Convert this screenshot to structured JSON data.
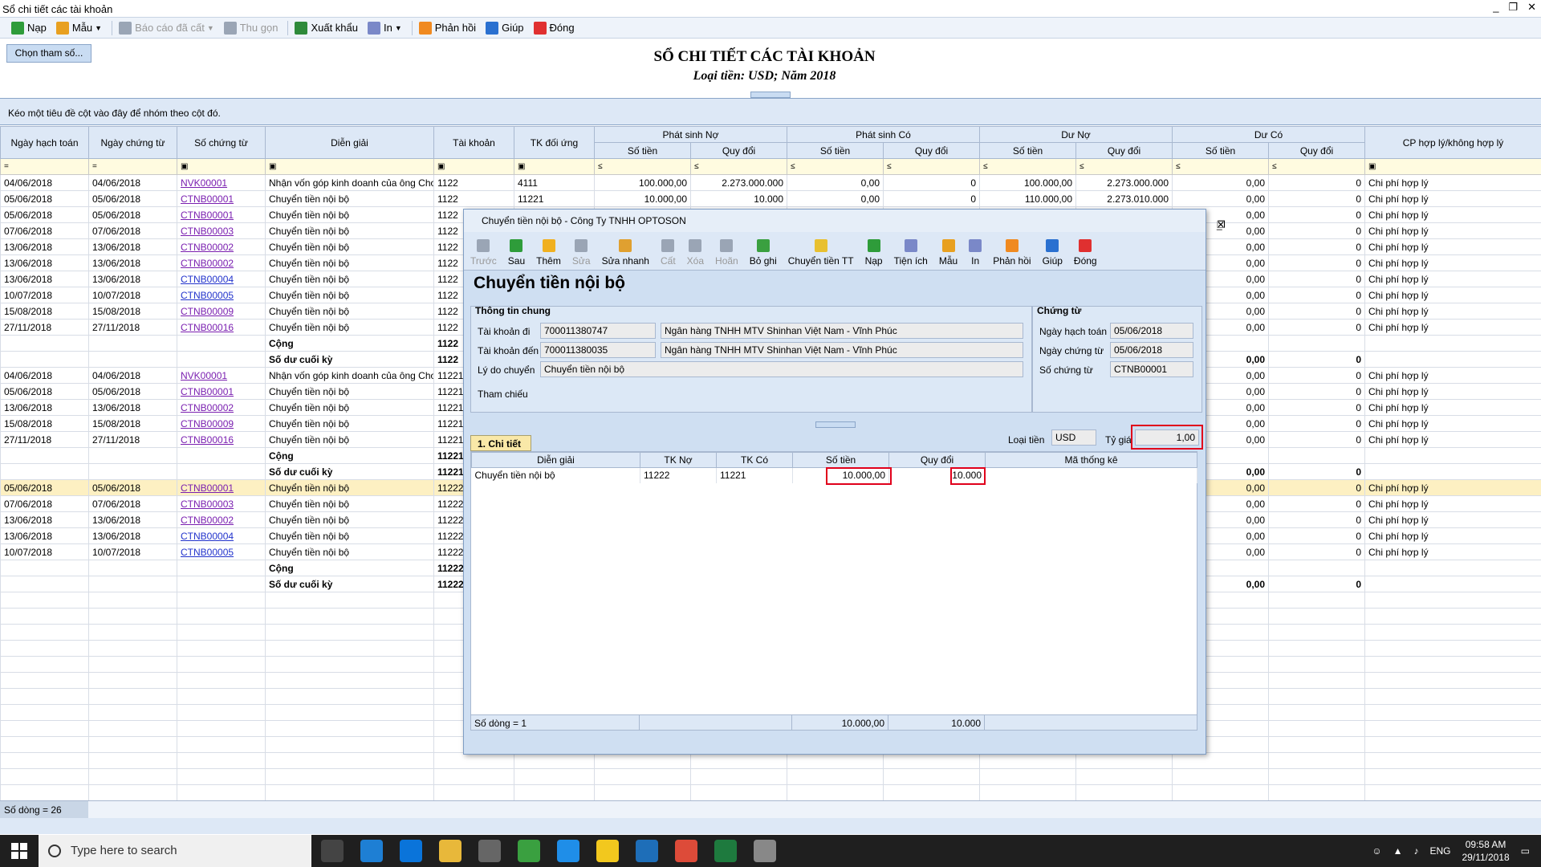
{
  "window": {
    "title": "Sổ chi tiết các tài khoản",
    "controls": [
      "_",
      "❐",
      "✕"
    ]
  },
  "toolbar": [
    {
      "label": "Nạp",
      "icon": "refresh-icon",
      "color": "#2e9c3a",
      "enabled": true,
      "dropdown": false
    },
    {
      "label": "Mẫu",
      "icon": "template-icon",
      "color": "#e8a020",
      "enabled": true,
      "dropdown": true
    },
    {
      "label": "Báo cáo đã cất",
      "icon": "saved-report-icon",
      "color": "#9aa5b5",
      "enabled": false,
      "dropdown": true
    },
    {
      "label": "Thu gọn",
      "icon": "collapse-icon",
      "color": "#9aa5b5",
      "enabled": false,
      "dropdown": false
    },
    {
      "label": "Xuất khẩu",
      "icon": "export-icon",
      "color": "#2e8a3a",
      "enabled": true,
      "dropdown": false
    },
    {
      "label": "In",
      "icon": "print-icon",
      "color": "#7a88c8",
      "enabled": true,
      "dropdown": true
    },
    {
      "label": "Phản hồi",
      "icon": "feedback-icon",
      "color": "#f08a20",
      "enabled": true,
      "dropdown": false
    },
    {
      "label": "Giúp",
      "icon": "help-icon",
      "color": "#2a70d0",
      "enabled": true,
      "dropdown": false
    },
    {
      "label": "Đóng",
      "icon": "close-icon",
      "color": "#e03030",
      "enabled": true,
      "dropdown": false
    }
  ],
  "params_button": "Chọn tham số...",
  "report": {
    "title": "SỔ CHI TIẾT CÁC TÀI KHOẢN",
    "subtitle": "Loại tiền: USD; Năm 2018"
  },
  "group_hint": "Kéo một tiêu đề cột vào đây để nhóm theo cột đó.",
  "columns": {
    "ngay_ht": "Ngày hạch toán",
    "ngay_ct": "Ngày chứng từ",
    "so_ct": "Số chứng từ",
    "dien_giai": "Diễn giải",
    "tk": "Tài khoản",
    "tk_du": "TK đối ứng",
    "ps_no": "Phát sinh Nợ",
    "ps_co": "Phát sinh Có",
    "du_no": "Dư Nợ",
    "du_co": "Dư Có",
    "so_tien": "Số tiền",
    "quy_doi": "Quy đổi",
    "cp": "CP hợp lý/không hợp lý"
  },
  "filter_ops": {
    "eq": "=",
    "le": "≤",
    "box": "▣"
  },
  "rows": [
    {
      "d1": "04/06/2018",
      "d2": "04/06/2018",
      "no": "NVK00001",
      "v": 1,
      "dg": "Nhận vốn góp kinh doanh của ông Choi,",
      "tk": "1122",
      "du": "4111",
      "a1": "100.000,00",
      "a2": "2.273.000.000",
      "a3": "0,00",
      "a4": "0",
      "a5": "100.000,00",
      "a6": "2.273.000.000",
      "a7": "0,00",
      "a8": "0",
      "cp": "Chi phí hợp lý"
    },
    {
      "d1": "05/06/2018",
      "d2": "05/06/2018",
      "no": "CTNB00001",
      "v": 1,
      "dg": "Chuyển tiền nội bộ",
      "tk": "1122",
      "du": "11221",
      "a1": "10.000,00",
      "a2": "10.000",
      "a3": "0,00",
      "a4": "0",
      "a5": "110.000,00",
      "a6": "2.273.010.000",
      "a7": "0,00",
      "a8": "0",
      "cp": "Chi phí hợp lý"
    },
    {
      "d1": "05/06/2018",
      "d2": "05/06/2018",
      "no": "CTNB00001",
      "v": 1,
      "dg": "Chuyển tiền nội bộ",
      "tk": "1122",
      "a7": "0,00",
      "a8": "0",
      "cp": "Chi phí hợp lý"
    },
    {
      "d1": "07/06/2018",
      "d2": "07/06/2018",
      "no": "CTNB00003",
      "v": 1,
      "dg": "Chuyển tiền nội bộ",
      "tk": "1122",
      "a7": "0,00",
      "a8": "0",
      "cp": "Chi phí hợp lý"
    },
    {
      "d1": "13/06/2018",
      "d2": "13/06/2018",
      "no": "CTNB00002",
      "v": 1,
      "dg": "Chuyển tiền nội bộ",
      "tk": "1122",
      "a7": "0,00",
      "a8": "0",
      "cp": "Chi phí hợp lý"
    },
    {
      "d1": "13/06/2018",
      "d2": "13/06/2018",
      "no": "CTNB00002",
      "v": 1,
      "dg": "Chuyển tiền nội bộ",
      "tk": "1122",
      "a7": "0,00",
      "a8": "0",
      "cp": "Chi phí hợp lý"
    },
    {
      "d1": "13/06/2018",
      "d2": "13/06/2018",
      "no": "CTNB00004",
      "v": 2,
      "dg": "Chuyển tiền nội bộ",
      "tk": "1122",
      "a7": "0,00",
      "a8": "0",
      "cp": "Chi phí hợp lý"
    },
    {
      "d1": "10/07/2018",
      "d2": "10/07/2018",
      "no": "CTNB00005",
      "v": 2,
      "dg": "Chuyển tiền nội bộ",
      "tk": "1122",
      "a7": "0,00",
      "a8": "0",
      "cp": "Chi phí hợp lý"
    },
    {
      "d1": "15/08/2018",
      "d2": "15/08/2018",
      "no": "CTNB00009",
      "v": 1,
      "dg": "Chuyển tiền nội bộ",
      "tk": "1122",
      "a7": "0,00",
      "a8": "0",
      "cp": "Chi phí hợp lý"
    },
    {
      "d1": "27/11/2018",
      "d2": "27/11/2018",
      "no": "CTNB00016",
      "v": 1,
      "dg": "Chuyển tiền nội bộ",
      "tk": "1122",
      "a7": "0,00",
      "a8": "0",
      "cp": "Chi phí hợp lý"
    },
    {
      "dg": "Cộng",
      "tk": "1122",
      "bold": true
    },
    {
      "dg": "Số dư cuối kỳ",
      "tk": "1122",
      "a7": "0,00",
      "a8": "0",
      "bold": true
    },
    {
      "d1": "04/06/2018",
      "d2": "04/06/2018",
      "no": "NVK00001",
      "v": 1,
      "dg": "Nhận vốn góp kinh doanh của ông Choi,",
      "tk": "11221",
      "a7": "0,00",
      "a8": "0",
      "cp": "Chi phí hợp lý"
    },
    {
      "d1": "05/06/2018",
      "d2": "05/06/2018",
      "no": "CTNB00001",
      "v": 1,
      "dg": "Chuyển tiền nội bộ",
      "tk": "11221",
      "a7": "0,00",
      "a8": "0",
      "cp": "Chi phí hợp lý"
    },
    {
      "d1": "13/06/2018",
      "d2": "13/06/2018",
      "no": "CTNB00002",
      "v": 1,
      "dg": "Chuyển tiền nội bộ",
      "tk": "11221",
      "a7": "0,00",
      "a8": "0",
      "cp": "Chi phí hợp lý"
    },
    {
      "d1": "15/08/2018",
      "d2": "15/08/2018",
      "no": "CTNB00009",
      "v": 1,
      "dg": "Chuyển tiền nội bộ",
      "tk": "11221",
      "a7": "0,00",
      "a8": "0",
      "cp": "Chi phí hợp lý"
    },
    {
      "d1": "27/11/2018",
      "d2": "27/11/2018",
      "no": "CTNB00016",
      "v": 1,
      "dg": "Chuyển tiền nội bộ",
      "tk": "11221",
      "a7": "0,00",
      "a8": "0",
      "cp": "Chi phí hợp lý"
    },
    {
      "dg": "Cộng",
      "tk": "11221",
      "bold": true
    },
    {
      "dg": "Số dư cuối kỳ",
      "tk": "11221",
      "a7": "0,00",
      "a8": "0",
      "bold": true
    },
    {
      "d1": "05/06/2018",
      "d2": "05/06/2018",
      "no": "CTNB00001",
      "v": 1,
      "dg": "Chuyển tiền nội bộ",
      "tk": "11222",
      "a7": "0,00",
      "a8": "0",
      "cp": "Chi phí hợp lý",
      "sel": true
    },
    {
      "d1": "07/06/2018",
      "d2": "07/06/2018",
      "no": "CTNB00003",
      "v": 1,
      "dg": "Chuyển tiền nội bộ",
      "tk": "11222",
      "a7": "0,00",
      "a8": "0",
      "cp": "Chi phí hợp lý"
    },
    {
      "d1": "13/06/2018",
      "d2": "13/06/2018",
      "no": "CTNB00002",
      "v": 1,
      "dg": "Chuyển tiền nội bộ",
      "tk": "11222",
      "a7": "0,00",
      "a8": "0",
      "cp": "Chi phí hợp lý"
    },
    {
      "d1": "13/06/2018",
      "d2": "13/06/2018",
      "no": "CTNB00004",
      "v": 2,
      "dg": "Chuyển tiền nội bộ",
      "tk": "11222",
      "a7": "0,00",
      "a8": "0",
      "cp": "Chi phí hợp lý"
    },
    {
      "d1": "10/07/2018",
      "d2": "10/07/2018",
      "no": "CTNB00005",
      "v": 2,
      "dg": "Chuyển tiền nội bộ",
      "tk": "11222",
      "a7": "0,00",
      "a8": "0",
      "cp": "Chi phí hợp lý"
    },
    {
      "dg": "Cộng",
      "tk": "11222",
      "bold": true
    },
    {
      "dg": "Số dư cuối kỳ",
      "tk": "11222",
      "a7": "0,00",
      "a8": "0",
      "bold": true
    }
  ],
  "status": "Số dòng = 26",
  "dialog": {
    "title": "Chuyển tiền nội bộ - Công Ty TNHH OPTOSON",
    "toolbar": [
      {
        "label": "Trước",
        "color": "#9aa5b5",
        "enabled": false,
        "icon": "back-arrow-icon"
      },
      {
        "label": "Sau",
        "color": "#2e9c3a",
        "enabled": true,
        "icon": "forward-arrow-icon"
      },
      {
        "label": "Thêm",
        "color": "#f0b020",
        "enabled": true,
        "icon": "add-icon"
      },
      {
        "label": "Sửa",
        "color": "#9aa5b5",
        "enabled": false,
        "icon": "edit-icon"
      },
      {
        "label": "Sửa nhanh",
        "color": "#e0a030",
        "enabled": true,
        "icon": "quick-edit-icon"
      },
      {
        "label": "Cất",
        "color": "#9aa5b5",
        "enabled": false,
        "icon": "save-icon"
      },
      {
        "label": "Xóa",
        "color": "#9aa5b5",
        "enabled": false,
        "icon": "delete-icon"
      },
      {
        "label": "Hoãn",
        "color": "#9aa5b5",
        "enabled": false,
        "icon": "undo-icon"
      },
      {
        "label": "Bỏ ghi",
        "color": "#3aa040",
        "enabled": true,
        "icon": "unpost-icon"
      },
      {
        "label": "Chuyển tiền TT",
        "color": "#e8c030",
        "enabled": true,
        "icon": "transfer-icon"
      },
      {
        "label": "Nạp",
        "color": "#2e9c3a",
        "enabled": true,
        "icon": "refresh-icon"
      },
      {
        "label": "Tiện ích",
        "color": "#7a88c8",
        "enabled": true,
        "icon": "utility-icon"
      },
      {
        "label": "Mẫu",
        "color": "#e8a020",
        "enabled": true,
        "icon": "template-icon"
      },
      {
        "label": "In",
        "color": "#7a88c8",
        "enabled": true,
        "icon": "print-icon"
      },
      {
        "label": "Phản hồi",
        "color": "#f08a20",
        "enabled": true,
        "icon": "feedback-icon"
      },
      {
        "label": "Giúp",
        "color": "#2a70d0",
        "enabled": true,
        "icon": "help-icon"
      },
      {
        "label": "Đóng",
        "color": "#e03030",
        "enabled": true,
        "icon": "close-icon"
      }
    ],
    "heading": "Chuyển tiền nội bộ",
    "info": {
      "legend": "Thông tin chung",
      "tk_di_label": "Tài khoản đi",
      "tk_di": "700011380747",
      "tk_di_bank": "Ngân hàng TNHH MTV Shinhan Việt Nam - Vĩnh Phúc",
      "tk_den_label": "Tài khoản đến",
      "tk_den": "700011380035",
      "tk_den_bank": "Ngân hàng TNHH MTV Shinhan Việt Nam - Vĩnh Phúc",
      "ly_do_label": "Lý do chuyển",
      "ly_do": "Chuyển tiền nội bộ",
      "tham_chieu_label": "Tham chiếu"
    },
    "voucher": {
      "legend": "Chứng từ",
      "ngay_ht_label": "Ngày hạch toán",
      "ngay_ht": "05/06/2018",
      "ngay_ct_label": "Ngày chứng từ",
      "ngay_ct": "05/06/2018",
      "so_ct_label": "Số chứng từ",
      "so_ct": "CTNB00001"
    },
    "currency_label": "Loại tiền",
    "currency": "USD",
    "rate_label": "Tỷ giá",
    "rate": "1,00",
    "tab": "1. Chi tiết",
    "cols": [
      "Diễn giải",
      "TK Nợ",
      "TK Có",
      "Số tiền",
      "Quy đổi",
      "Mã thống kê"
    ],
    "row": {
      "dg": "Chuyển tiền nội bộ",
      "no": "11222",
      "co": "11221",
      "so_tien": "10.000,00",
      "quy_doi": "10.000"
    },
    "footer": {
      "count": "Số dòng = 1",
      "so_tien": "10.000,00",
      "quy_doi": "10.000"
    }
  },
  "taskbar": {
    "search": "Type here to search",
    "lang": "ENG",
    "time": "09:58 AM",
    "date": "29/11/2018"
  }
}
